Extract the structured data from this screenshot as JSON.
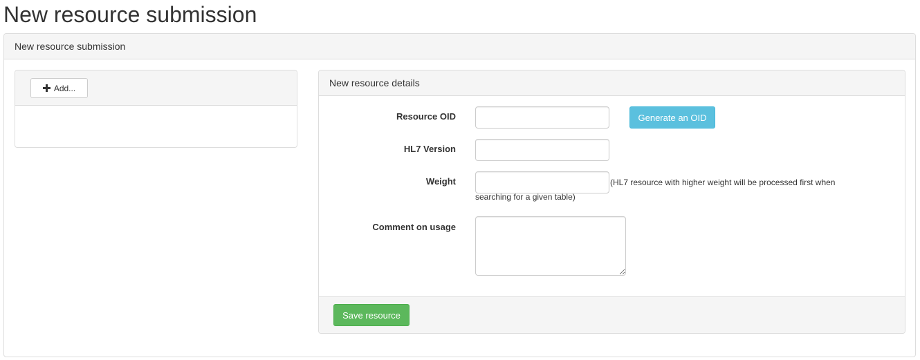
{
  "page": {
    "title": "New resource submission"
  },
  "outer_panel": {
    "heading": "New resource submission"
  },
  "left_panel": {
    "add_label": "Add...",
    "add_icon": "plus-icon"
  },
  "details": {
    "heading": "New resource details",
    "resource_oid": {
      "label": "Resource OID",
      "value": ""
    },
    "generate_oid_label": "Generate an OID",
    "hl7_version": {
      "label": "HL7 Version",
      "value": ""
    },
    "weight": {
      "label": "Weight",
      "value": "",
      "help_part1": "(HL7 resource with higher weight will be processed first when",
      "help_part2": "searching for a given table)"
    },
    "comment": {
      "label": "Comment on usage",
      "value": ""
    },
    "save_label": "Save resource"
  },
  "colors": {
    "info_button": "#5bc0de",
    "success_button": "#5cb85c",
    "panel_heading_bg": "#f5f5f5",
    "border": "#dddddd"
  }
}
